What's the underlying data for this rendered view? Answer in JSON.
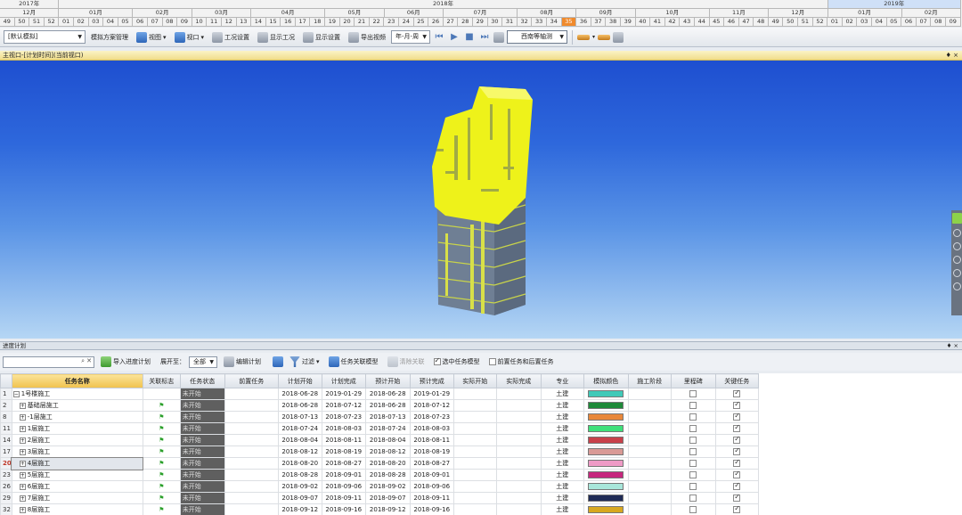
{
  "timeline": {
    "years": [
      {
        "label": "2017年",
        "span": 4
      },
      {
        "label": "2018年",
        "span": 52
      },
      {
        "label": "2019年",
        "span": 9
      }
    ],
    "months": [
      {
        "label": "12月",
        "span": 4
      },
      {
        "label": "01月",
        "span": 5
      },
      {
        "label": "02月",
        "span": 4
      },
      {
        "label": "03月",
        "span": 4
      },
      {
        "label": "04月",
        "span": 5
      },
      {
        "label": "05月",
        "span": 4
      },
      {
        "label": "06月",
        "span": 4
      },
      {
        "label": "07月",
        "span": 5
      },
      {
        "label": "08月",
        "span": 4
      },
      {
        "label": "09月",
        "span": 4
      },
      {
        "label": "10月",
        "span": 5
      },
      {
        "label": "11月",
        "span": 4
      },
      {
        "label": "12月",
        "span": 4
      },
      {
        "label": "01月",
        "span": 5
      },
      {
        "label": "02月",
        "span": 4
      }
    ],
    "weeks": [
      "49",
      "50",
      "51",
      "52",
      "01",
      "02",
      "03",
      "04",
      "05",
      "06",
      "07",
      "08",
      "09",
      "10",
      "11",
      "12",
      "13",
      "14",
      "15",
      "16",
      "17",
      "18",
      "19",
      "20",
      "21",
      "22",
      "23",
      "24",
      "25",
      "26",
      "27",
      "28",
      "29",
      "30",
      "31",
      "32",
      "33",
      "34",
      "35",
      "36",
      "37",
      "38",
      "39",
      "40",
      "41",
      "42",
      "43",
      "44",
      "45",
      "46",
      "47",
      "48",
      "49",
      "50",
      "51",
      "52",
      "01",
      "02",
      "03",
      "04",
      "05",
      "06",
      "07",
      "08",
      "09"
    ],
    "current_week_index": 38
  },
  "toolbar": {
    "scheme_select": "[默认模拟]",
    "scheme_manage": "模拟方案管理",
    "view": "视图",
    "viewport": "视口",
    "work_settings": "工况设置",
    "show_work": "显示工况",
    "display_settings": "显示设置",
    "export_video": "导出视频",
    "time_unit": "年-月-周",
    "view_direction": "西南等轴测"
  },
  "viewport": {
    "title": "主视口-[计划时间](当前视口)",
    "pin": "♦ ×"
  },
  "panel": {
    "title": "进度计划",
    "pin": "♦ ×",
    "import_plan": "导入进度计划",
    "expand_to_label": "展开至：",
    "expand_to_value": "全部",
    "edit_plan": "编辑计划",
    "filter": "过滤",
    "task_link_model": "任务关联模型",
    "clear_link": "清除关联",
    "check_selected_model": "选中任务模型",
    "check_pre_post": "前置任务和后置任务"
  },
  "columns": [
    "任务名称",
    "关联标志",
    "任务状态",
    "前置任务",
    "计划开始",
    "计划完成",
    "预计开始",
    "预计完成",
    "实际开始",
    "实际完成",
    "专业",
    "模拟颜色",
    "施工阶段",
    "里程碑",
    "关键任务"
  ],
  "rows": [
    {
      "num": "1",
      "name": "1号楼施工",
      "indent": 0,
      "expander": "−",
      "flag": false,
      "status": "未开始",
      "plan_start": "2018-06-28",
      "plan_end": "2019-01-29",
      "est_start": "2018-06-28",
      "est_end": "2019-01-29",
      "discipline": "土建",
      "color": "#3fc9b8",
      "milestone": false,
      "critical": true
    },
    {
      "num": "2",
      "name": "基础层施工",
      "indent": 1,
      "expander": "+",
      "flag": true,
      "status": "未开始",
      "plan_start": "2018-06-28",
      "plan_end": "2018-07-12",
      "est_start": "2018-06-28",
      "est_end": "2018-07-12",
      "discipline": "土建",
      "color": "#1f8a3a",
      "milestone": false,
      "critical": true
    },
    {
      "num": "8",
      "name": "-1层施工",
      "indent": 1,
      "expander": "+",
      "flag": true,
      "status": "未开始",
      "plan_start": "2018-07-13",
      "plan_end": "2018-07-23",
      "est_start": "2018-07-13",
      "est_end": "2018-07-23",
      "discipline": "土建",
      "color": "#e8873a",
      "milestone": false,
      "critical": true
    },
    {
      "num": "11",
      "name": "1层施工",
      "indent": 1,
      "expander": "+",
      "flag": true,
      "status": "未开始",
      "plan_start": "2018-07-24",
      "plan_end": "2018-08-03",
      "est_start": "2018-07-24",
      "est_end": "2018-08-03",
      "discipline": "土建",
      "color": "#3ee07a",
      "milestone": false,
      "critical": true
    },
    {
      "num": "14",
      "name": "2层施工",
      "indent": 1,
      "expander": "+",
      "flag": true,
      "status": "未开始",
      "plan_start": "2018-08-04",
      "plan_end": "2018-08-11",
      "est_start": "2018-08-04",
      "est_end": "2018-08-11",
      "discipline": "土建",
      "color": "#c8404a",
      "milestone": false,
      "critical": true
    },
    {
      "num": "17",
      "name": "3层施工",
      "indent": 1,
      "expander": "+",
      "flag": true,
      "status": "未开始",
      "plan_start": "2018-08-12",
      "plan_end": "2018-08-19",
      "est_start": "2018-08-12",
      "est_end": "2018-08-19",
      "discipline": "土建",
      "color": "#d99a96",
      "milestone": false,
      "critical": true
    },
    {
      "num": "20",
      "name": "4层施工",
      "indent": 1,
      "expander": "+",
      "flag": true,
      "status": "未开始",
      "plan_start": "2018-08-20",
      "plan_end": "2018-08-27",
      "est_start": "2018-08-20",
      "est_end": "2018-08-27",
      "discipline": "土建",
      "color": "#ee9ac6",
      "milestone": false,
      "critical": true
    },
    {
      "num": "23",
      "name": "5层施工",
      "indent": 1,
      "expander": "+",
      "flag": true,
      "status": "未开始",
      "plan_start": "2018-08-28",
      "plan_end": "2018-09-01",
      "est_start": "2018-08-28",
      "est_end": "2018-09-01",
      "discipline": "土建",
      "color": "#c6287e",
      "milestone": false,
      "critical": true
    },
    {
      "num": "26",
      "name": "6层施工",
      "indent": 1,
      "expander": "+",
      "flag": true,
      "status": "未开始",
      "plan_start": "2018-09-02",
      "plan_end": "2018-09-06",
      "est_start": "2018-09-02",
      "est_end": "2018-09-06",
      "discipline": "土建",
      "color": "#a8e6da",
      "milestone": false,
      "critical": true
    },
    {
      "num": "29",
      "name": "7层施工",
      "indent": 1,
      "expander": "+",
      "flag": true,
      "status": "未开始",
      "plan_start": "2018-09-07",
      "plan_end": "2018-09-11",
      "est_start": "2018-09-07",
      "est_end": "2018-09-11",
      "discipline": "土建",
      "color": "#1e2a55",
      "milestone": false,
      "critical": true
    },
    {
      "num": "32",
      "name": "8层施工",
      "indent": 1,
      "expander": "+",
      "flag": true,
      "status": "未开始",
      "plan_start": "2018-09-12",
      "plan_end": "2018-09-16",
      "est_start": "2018-09-12",
      "est_end": "2018-09-16",
      "discipline": "土建",
      "color": "#d8a820",
      "milestone": false,
      "critical": true
    }
  ],
  "selected_row_num": "20"
}
